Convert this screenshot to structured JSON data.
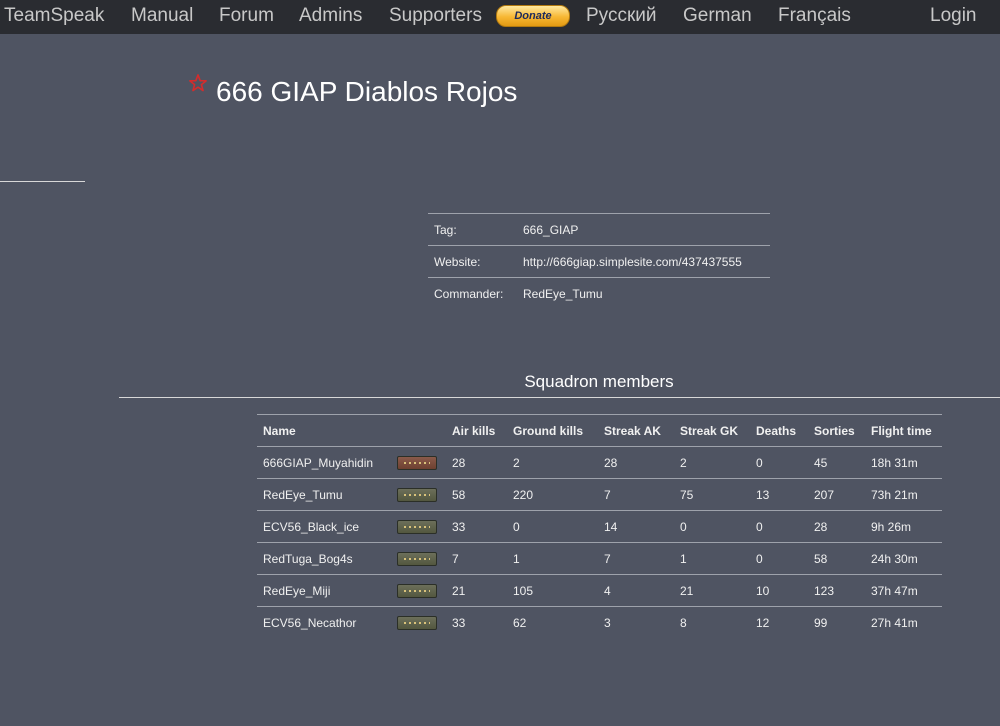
{
  "nav": {
    "items": [
      "TeamSpeak",
      "Manual",
      "Forum",
      "Admins",
      "Supporters"
    ],
    "donate_label": "Donate",
    "languages": [
      "Русский",
      "German",
      "Français"
    ],
    "login_label": "Login"
  },
  "squadron": {
    "title": "666 GIAP Diablos Rojos",
    "info": [
      {
        "label": "Tag:",
        "value": "666_GIAP"
      },
      {
        "label": "Website:",
        "value": "http://666giap.simplesite.com/437437555"
      },
      {
        "label": "Commander:",
        "value": "RedEye_Tumu"
      }
    ]
  },
  "members": {
    "heading": "Squadron members",
    "columns": [
      "Name",
      "Air kills",
      "Ground kills",
      "Streak AK",
      "Streak GK",
      "Deaths",
      "Sorties",
      "Flight time"
    ],
    "rows": [
      {
        "name": "666GIAP_Muyahidin",
        "badge": "red",
        "cells": [
          "28",
          "2",
          "28",
          "2",
          "0",
          "45",
          "18h 31m"
        ]
      },
      {
        "name": "RedEye_Tumu",
        "badge": "green",
        "cells": [
          "58",
          "220",
          "7",
          "75",
          "13",
          "207",
          "73h 21m"
        ]
      },
      {
        "name": "ECV56_Black_ice",
        "badge": "green",
        "cells": [
          "33",
          "0",
          "14",
          "0",
          "0",
          "28",
          "9h 26m"
        ]
      },
      {
        "name": "RedTuga_Bog4s",
        "badge": "green",
        "cells": [
          "7",
          "1",
          "7",
          "1",
          "0",
          "58",
          "24h 30m"
        ]
      },
      {
        "name": "RedEye_Miji",
        "badge": "green",
        "cells": [
          "21",
          "105",
          "4",
          "21",
          "10",
          "123",
          "37h 47m"
        ]
      },
      {
        "name": "ECV56_Necathor",
        "badge": "green",
        "cells": [
          "33",
          "62",
          "3",
          "8",
          "12",
          "99",
          "27h 41m"
        ]
      }
    ]
  },
  "colors": {
    "background": "#4f5462",
    "nav_background": "#2a2c31",
    "star": "#d42c2c"
  }
}
